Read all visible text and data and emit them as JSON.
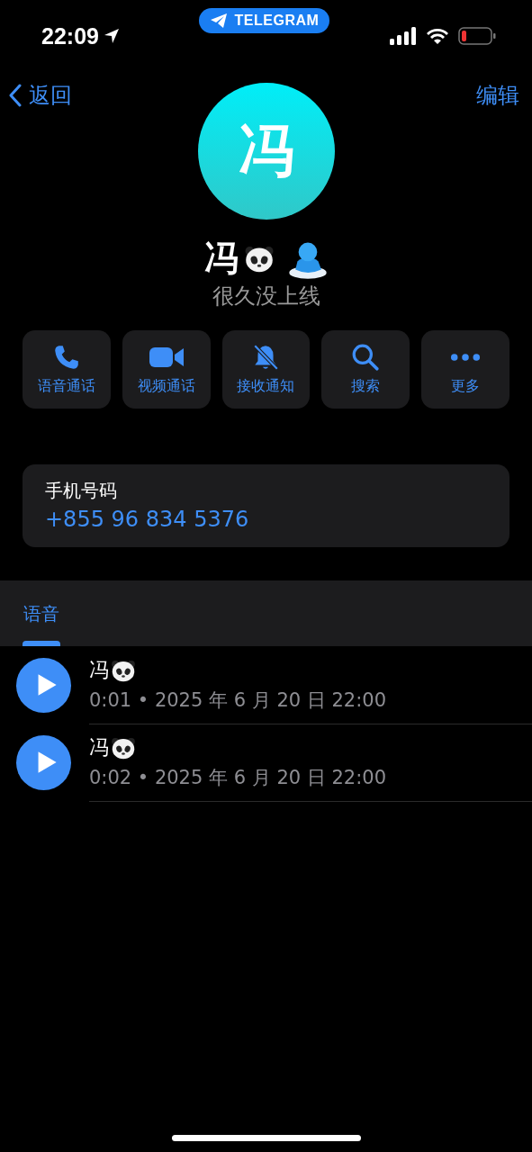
{
  "status_bar": {
    "time": "22:09",
    "app_pill": "TELEGRAM"
  },
  "nav": {
    "back": "返回",
    "edit": "编辑"
  },
  "profile": {
    "avatar_letter": "冯",
    "name": "冯",
    "status": "很久没上线"
  },
  "actions": [
    {
      "kind": "phone",
      "label": "语音通话"
    },
    {
      "kind": "video",
      "label": "视频通话"
    },
    {
      "kind": "bell-off",
      "label": "接收通知"
    },
    {
      "kind": "search",
      "label": "搜索"
    },
    {
      "kind": "more",
      "label": "更多"
    }
  ],
  "info": {
    "label": "手机号码",
    "value": "+855 96 834 5376"
  },
  "tabs": [
    {
      "label": "语音",
      "selected": true
    }
  ],
  "voice_messages": [
    {
      "sender": "冯",
      "meta": "0:01 • 2025 年 6 月 20 日 22:00"
    },
    {
      "sender": "冯",
      "meta": "0:02 • 2025 年 6 月 20 日 22:00"
    }
  ]
}
